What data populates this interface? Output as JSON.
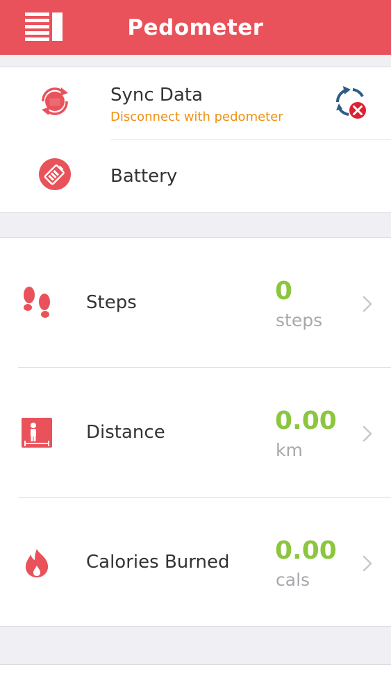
{
  "header": {
    "title": "Pedometer",
    "menu_icon": "list-menu-icon",
    "color": "#e9525a"
  },
  "device": {
    "sync": {
      "title": "Sync Data",
      "subtitle": "Disconnect with pedometer",
      "icon": "sync-icon",
      "status_icon": "disconnected-sync-icon"
    },
    "battery": {
      "title": "Battery",
      "icon": "battery-icon"
    }
  },
  "stats": [
    {
      "label": "Steps",
      "value": "0",
      "unit": "steps",
      "icon": "footprints-icon"
    },
    {
      "label": "Distance",
      "value": "0.00",
      "unit": "km",
      "icon": "distance-icon"
    },
    {
      "label": "Calories Burned",
      "value": "0.00",
      "unit": "cals",
      "icon": "flame-icon"
    }
  ],
  "colors": {
    "accent": "#e9525a",
    "value_green": "#8cc63f",
    "warning_orange": "#f0900f",
    "unit_gray": "#a8a8ac"
  }
}
